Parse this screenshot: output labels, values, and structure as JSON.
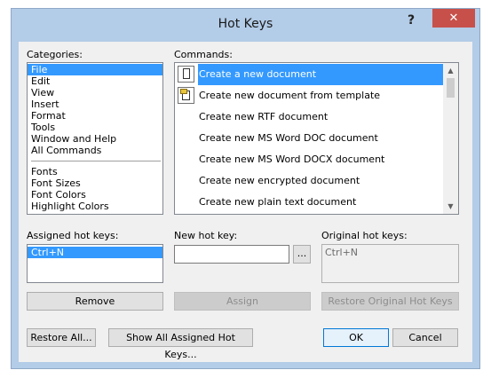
{
  "window": {
    "title": "Hot Keys",
    "help_glyph": "?",
    "close_glyph": "✕"
  },
  "categories": {
    "label": "Categories:",
    "group1": [
      "File",
      "Edit",
      "View",
      "Insert",
      "Format",
      "Tools",
      "Window and Help",
      "All Commands"
    ],
    "group2": [
      "Fonts",
      "Font Sizes",
      "Font Colors",
      "Highlight Colors"
    ],
    "selected": "File"
  },
  "commands": {
    "label": "Commands:",
    "items": [
      {
        "label": "Create a new document",
        "icon": "new-document-icon"
      },
      {
        "label": "Create new document from template",
        "icon": "template-document-icon"
      },
      {
        "label": "Create new RTF document",
        "icon": ""
      },
      {
        "label": "Create new MS Word DOC document",
        "icon": ""
      },
      {
        "label": "Create new MS Word DOCX document",
        "icon": ""
      },
      {
        "label": "Create new encrypted document",
        "icon": ""
      },
      {
        "label": "Create new plain text document",
        "icon": ""
      }
    ],
    "selected": "Create a new document"
  },
  "assigned": {
    "label": "Assigned hot keys:",
    "items": [
      "Ctrl+N"
    ]
  },
  "new_hot_key": {
    "label": "New hot key:",
    "value": "",
    "browse_label": "..."
  },
  "original": {
    "label": "Original hot keys:",
    "value": "Ctrl+N"
  },
  "buttons": {
    "remove": "Remove",
    "assign": "Assign",
    "restore_original": "Restore Original Hot Keys",
    "restore_all": "Restore All...",
    "show_all": "Show All Assigned Hot Keys...",
    "ok": "OK",
    "cancel": "Cancel"
  }
}
